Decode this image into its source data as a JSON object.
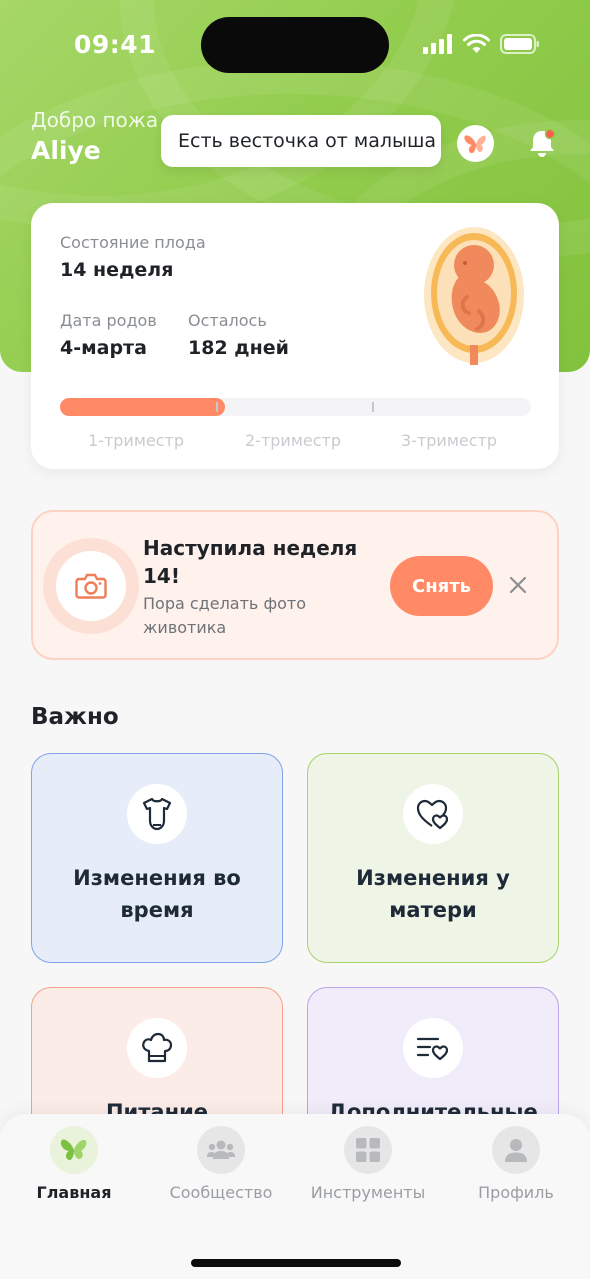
{
  "status_bar": {
    "time": "09:41"
  },
  "header": {
    "welcome": "Добро пожа",
    "user_name": "Aliye",
    "tooltip": "Есть весточка от малыша"
  },
  "fetus_card": {
    "state_label": "Состояние плода",
    "state_value": "14 неделя",
    "due_label": "Дата родов",
    "due_value": "4-марта",
    "left_label": "Осталось",
    "left_value": "182 дней",
    "progress_fraction": 0.35,
    "trimesters": [
      "1-триместр",
      "2-триместр",
      "3-триместр"
    ]
  },
  "photo_reminder": {
    "title": "Наступила неделя 14!",
    "subtitle": "Пора сделать фото животика",
    "button": "Снять"
  },
  "important": {
    "title": "Важно",
    "tiles": [
      {
        "label": "Изменения во время",
        "icon": "baby-bodysuit-icon"
      },
      {
        "label": "Изменения у матери",
        "icon": "hearts-icon"
      },
      {
        "label": "Питание",
        "icon": "chef-hat-icon"
      },
      {
        "label": "Дополнительные",
        "icon": "heart-list-icon"
      }
    ]
  },
  "tab_bar": {
    "tabs": [
      {
        "label": "Главная",
        "icon": "butterfly-icon",
        "active": true
      },
      {
        "label": "Сообщество",
        "icon": "community-icon",
        "active": false
      },
      {
        "label": "Инструменты",
        "icon": "grid-icon",
        "active": false
      },
      {
        "label": "Профиль",
        "icon": "profile-icon",
        "active": false
      }
    ]
  },
  "colors": {
    "brand_green": "#8fca4a",
    "accent_orange": "#ff8a65"
  }
}
